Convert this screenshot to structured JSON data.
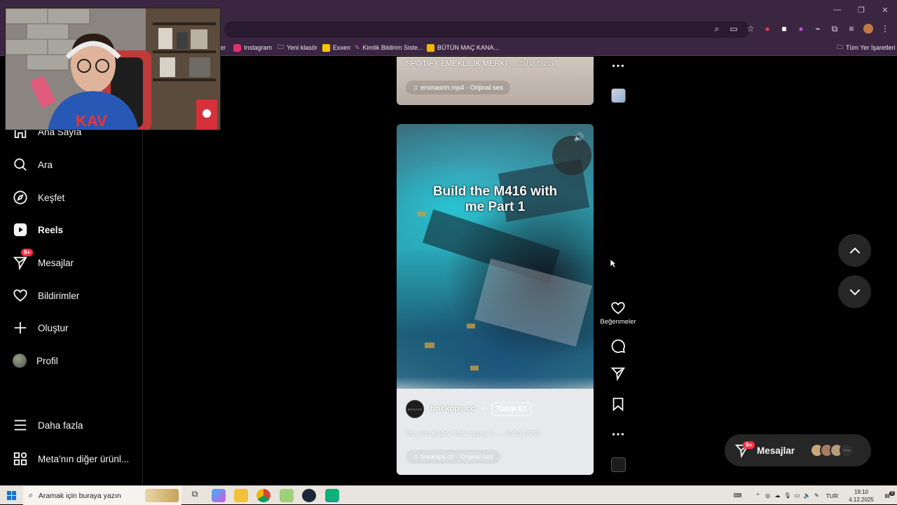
{
  "browser": {
    "bookmarks": [
      {
        "label": "er",
        "color": "#888"
      },
      {
        "label": "Instagram",
        "color": "#e1306c"
      },
      {
        "label": "Yeni klasör",
        "color": "#cfc3d6"
      },
      {
        "label": "Exxen",
        "color": "#f7c500"
      },
      {
        "label": "Kimlik Bildirim Siste...",
        "color": "#c86dd7"
      },
      {
        "label": "BÜTÜN MAÇ KANA...",
        "color": "#f2b600"
      }
    ],
    "bookmarks_all": "Tüm Yer İşaretleri"
  },
  "sidebar": {
    "items": [
      {
        "label": "Ana Sayfa",
        "icon": "home-icon"
      },
      {
        "label": "Ara",
        "icon": "search-icon"
      },
      {
        "label": "Keşfet",
        "icon": "compass-icon"
      },
      {
        "label": "Reels",
        "icon": "reels-icon"
      },
      {
        "label": "Mesajlar",
        "icon": "messenger-icon",
        "badge": "9+"
      },
      {
        "label": "Bildirimler",
        "icon": "heart-icon"
      },
      {
        "label": "Oluştur",
        "icon": "plus-icon"
      },
      {
        "label": "Profil",
        "icon": "avatar"
      }
    ],
    "more": "Daha fazla",
    "meta": "Meta'nın diğer ürünl..."
  },
  "reel_prev": {
    "caption": "SPOTİFY EMEKLİLİK MERKİ",
    "more": "... daha fazla",
    "audio": "ersinasrin.mp4 · Orijinal ses"
  },
  "reel": {
    "title_line1": "Build the M416 with",
    "title_line2": "me Part 1",
    "username": "brickops.co",
    "separator": "•",
    "follow": "Takip Et",
    "description": "Do you know how many b",
    "more": "... daha fazla",
    "audio": "brickops.co · Orijinal ses",
    "avatar_text": "BRICKOPS"
  },
  "actions": {
    "like_label": "Beğenmeler"
  },
  "messages_pill": {
    "label": "Mesajlar",
    "badge": "9+"
  },
  "taskbar": {
    "search_placeholder": "Aramak için buraya yazın",
    "lang": "TUR",
    "time": "19:10",
    "date": "4.12.2025",
    "notif_count": "5"
  }
}
